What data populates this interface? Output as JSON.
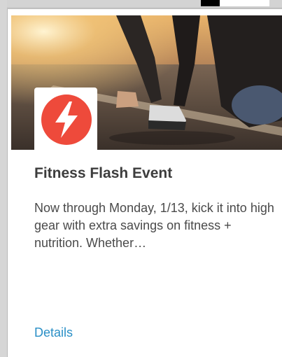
{
  "card": {
    "title": "Fitness Flash Event",
    "description": "Now through Monday, 1/13, kick it into high gear with extra savings on fitness + nutrition. Whether…",
    "details_label": "Details"
  },
  "badge": {
    "icon": "lightning-bolt-icon",
    "color": "#ee4a3b"
  },
  "hero_image": {
    "subject": "runner-at-starting-line"
  },
  "colors": {
    "link": "#2a8fc6",
    "title": "#3d3d3d",
    "body_text": "#4a4a4a"
  }
}
